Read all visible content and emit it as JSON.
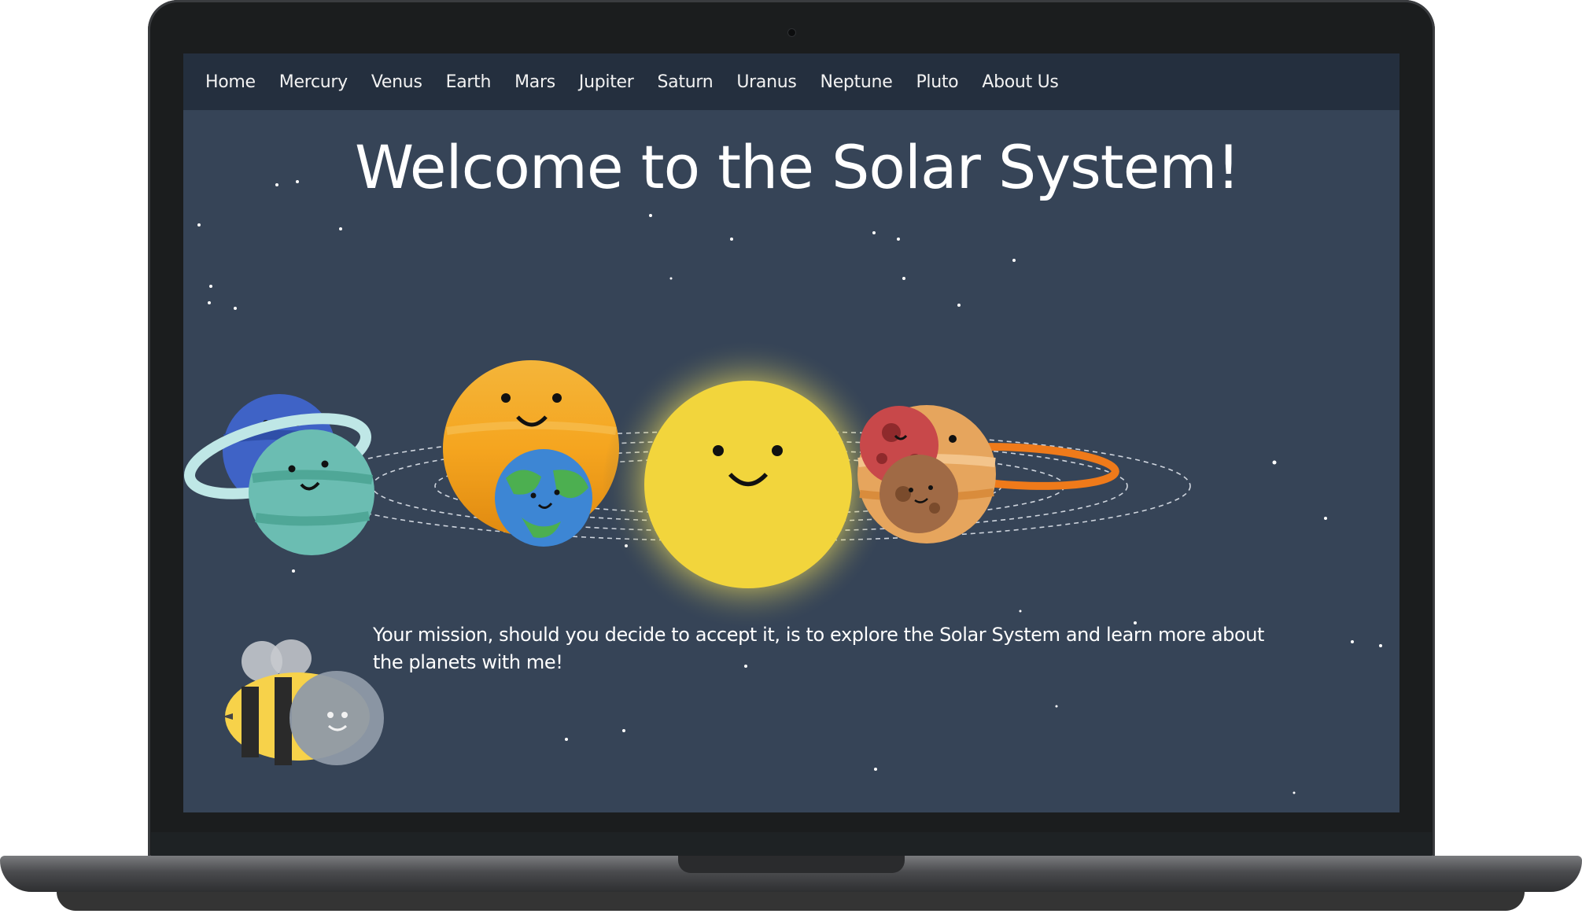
{
  "nav": {
    "items": [
      "Home",
      "Mercury",
      "Venus",
      "Earth",
      "Mars",
      "Jupiter",
      "Saturn",
      "Uranus",
      "Neptune",
      "Pluto",
      "About Us"
    ]
  },
  "hero": {
    "title": "Welcome to the Solar System!"
  },
  "mission": {
    "text": "Your mission, should you decide to accept it, is to explore the Solar System and learn more about the planets with me!"
  },
  "colors": {
    "page_bg": "#364457",
    "nav_bg": "#242f3e",
    "sun": "#f2d53c",
    "text": "#ffffff"
  },
  "illustration": {
    "subjects": [
      "sun-icon",
      "neptune-icon",
      "uranus-icon",
      "venus-icon",
      "earth-icon",
      "mars-icon",
      "jupiter-icon",
      "saturn-icon",
      "mercury-icon",
      "bee-mascot-icon"
    ]
  }
}
